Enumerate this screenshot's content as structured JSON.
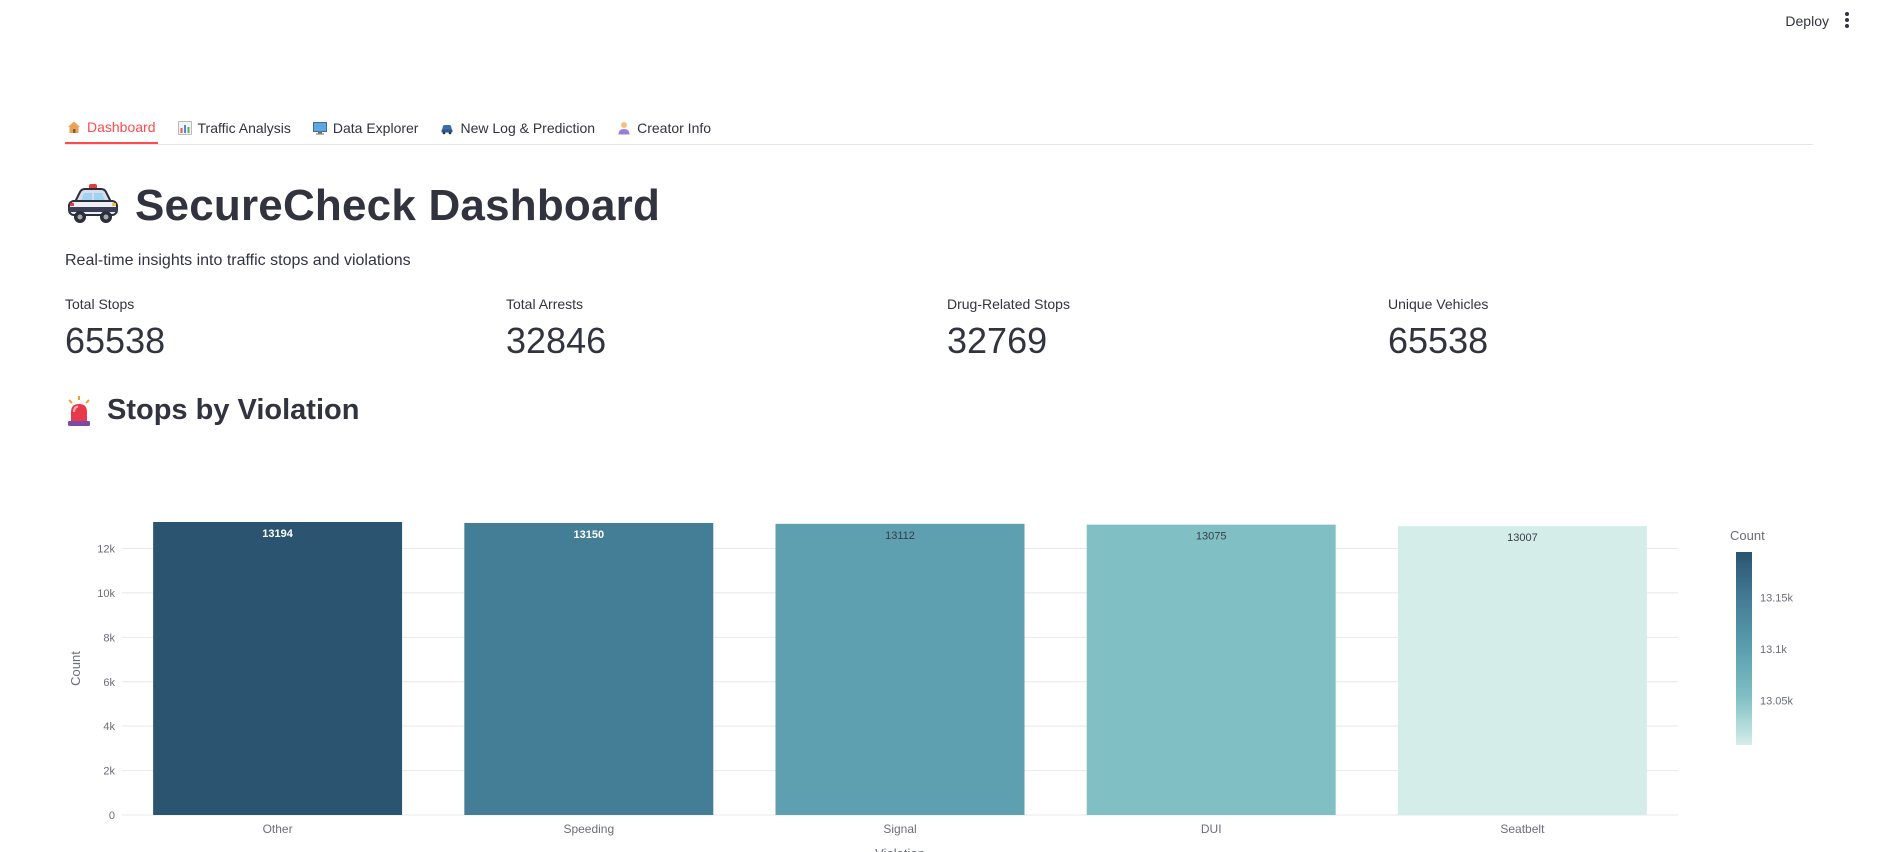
{
  "header": {
    "deploy_label": "Deploy"
  },
  "tabs": [
    {
      "icon": "house-icon",
      "label": "Dashboard",
      "active": true
    },
    {
      "icon": "bar-chart-icon",
      "label": "Traffic Analysis",
      "active": false
    },
    {
      "icon": "monitor-icon",
      "label": "Data Explorer",
      "active": false
    },
    {
      "icon": "car-icon",
      "label": "New Log & Prediction",
      "active": false
    },
    {
      "icon": "person-icon",
      "label": "Creator Info",
      "active": false
    }
  ],
  "page": {
    "title": "SecureCheck Dashboard",
    "title_icon": "police-car-icon",
    "subtitle": "Real-time insights into traffic stops and violations"
  },
  "metrics": [
    {
      "label": "Total Stops",
      "value": "65538"
    },
    {
      "label": "Total Arrests",
      "value": "32846"
    },
    {
      "label": "Drug-Related Stops",
      "value": "32769"
    },
    {
      "label": "Unique Vehicles",
      "value": "65538"
    }
  ],
  "section": {
    "title": "Stops by Violation",
    "icon": "siren-icon"
  },
  "chart_data": {
    "type": "bar",
    "categories": [
      "Other",
      "Speeding",
      "Signal",
      "DUI",
      "Seatbelt"
    ],
    "values": [
      13194,
      13150,
      13112,
      13075,
      13007
    ],
    "xlabel": "Violation",
    "ylabel": "Count",
    "ylim": [
      0,
      13194
    ],
    "yticks": [
      0,
      2000,
      4000,
      6000,
      8000,
      10000,
      12000
    ],
    "ytick_labels": [
      "0",
      "2k",
      "4k",
      "6k",
      "8k",
      "10k",
      "12k"
    ],
    "grid": true,
    "colorbar": {
      "title": "Count",
      "ticks": [
        13050,
        13100,
        13150
      ],
      "tick_labels": [
        "13.05k",
        "13.1k",
        "13.15k"
      ],
      "range": [
        13007,
        13194
      ],
      "colors": [
        "#d4ede9",
        "#80bfc4",
        "#5a9eaf",
        "#447d96",
        "#2b5471"
      ]
    },
    "bar_colors": [
      "#2b5471",
      "#447d96",
      "#5e9fb0",
      "#80bfc4",
      "#d4ede9"
    ]
  }
}
